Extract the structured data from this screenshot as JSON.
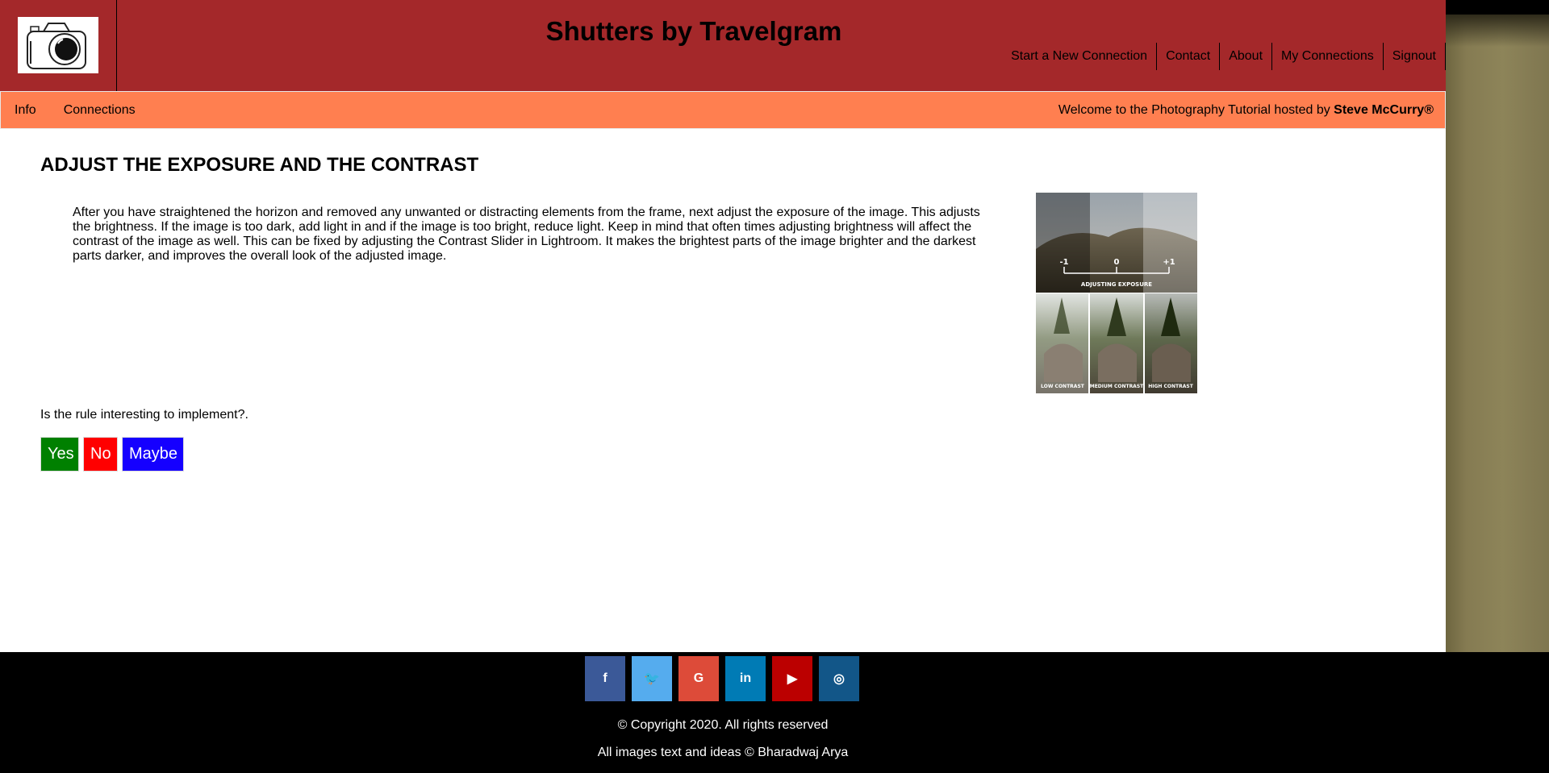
{
  "header": {
    "site_title": "Shutters by Travelgram",
    "logo_icon": "camera-icon",
    "nav": [
      {
        "label": "Start a New Connection"
      },
      {
        "label": "Contact"
      },
      {
        "label": "About"
      },
      {
        "label": "My Connections"
      },
      {
        "label": "Signout"
      }
    ],
    "colors": {
      "header_bg": "#a4282a",
      "subbar_bg": "#ff7f50"
    }
  },
  "subbar": {
    "tabs": [
      {
        "label": "Info"
      },
      {
        "label": "Connections"
      }
    ],
    "welcome_prefix": "Welcome to the Photography Tutorial hosted by ",
    "host_name": "Steve McCurry®"
  },
  "main": {
    "heading": "ADJUST THE EXPOSURE AND THE CONTRAST",
    "body": "After you have straightened the horizon and removed any unwanted or distracting elements from the frame, next adjust the exposure of the image. This adjusts the brightness. If the image is too dark, add light in and if the image is too bright, reduce light. Keep in mind that often times adjusting brightness will affect the contrast of the image as well. This can be fixed by adjusting the Contrast Slider in Lightroom. It makes the brightest parts of the image brighter and the darkest parts darker, and improves the overall look of the adjusted image.",
    "illustration": {
      "exposure_ticks": [
        "-1",
        "0",
        "+1"
      ],
      "exposure_caption": "ADJUSTING EXPOSURE",
      "contrast_labels": [
        "LOW CONTRAST",
        "MEDIUM CONTRAST",
        "HIGH CONTRAST"
      ]
    },
    "question": "Is the rule interesting to implement?.",
    "vote": {
      "yes": "Yes",
      "no": "No",
      "maybe": "Maybe",
      "colors": {
        "yes": "#008000",
        "no": "#ff0000",
        "maybe": "#1500ff"
      }
    }
  },
  "footer": {
    "socials": [
      {
        "icon": "facebook-icon",
        "glyph": "f",
        "color": "#3b5998"
      },
      {
        "icon": "twitter-icon",
        "glyph": "🐦",
        "color": "#55acee"
      },
      {
        "icon": "google-icon",
        "glyph": "G",
        "color": "#dd4b39"
      },
      {
        "icon": "linkedin-icon",
        "glyph": "in",
        "color": "#007bb5"
      },
      {
        "icon": "youtube-icon",
        "glyph": "▶",
        "color": "#bb0000"
      },
      {
        "icon": "instagram-icon",
        "glyph": "◎",
        "color": "#125688"
      }
    ],
    "copyright": "© Copyright 2020. All rights reserved",
    "credits": "All images text and ideas © Bharadwaj Arya"
  }
}
